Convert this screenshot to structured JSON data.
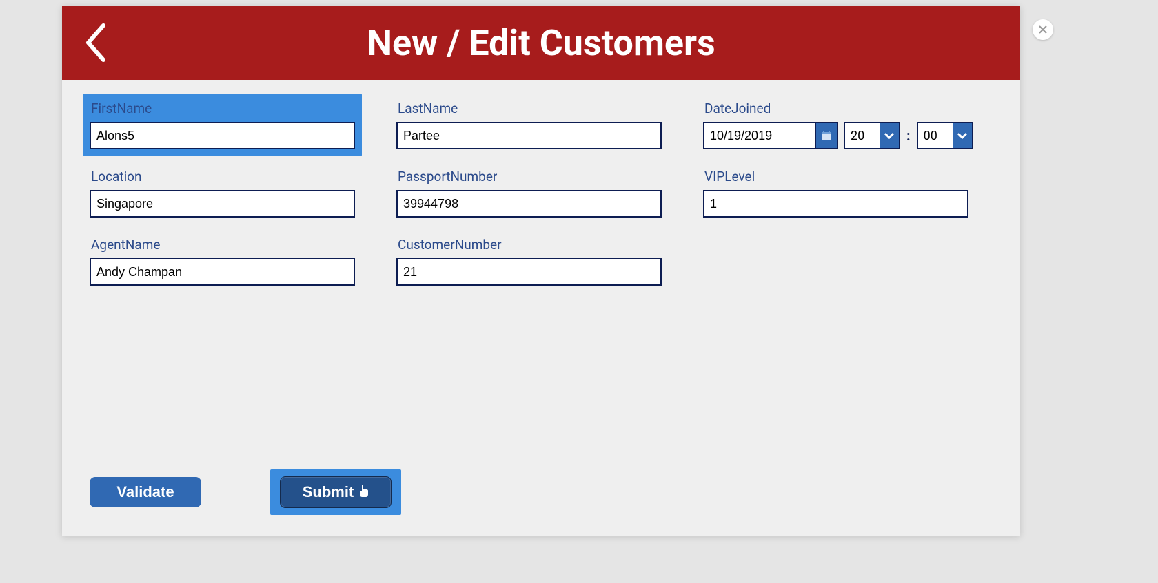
{
  "header": {
    "title": "New / Edit Customers"
  },
  "fields": {
    "firstName": {
      "label": "FirstName",
      "value": "Alons5"
    },
    "lastName": {
      "label": "LastName",
      "value": "Partee"
    },
    "dateJoined": {
      "label": "DateJoined",
      "date": "10/19/2019",
      "hour": "20",
      "minute": "00",
      "colon": ":"
    },
    "location": {
      "label": "Location",
      "value": "Singapore"
    },
    "passportNumber": {
      "label": "PassportNumber",
      "value": "39944798"
    },
    "vipLevel": {
      "label": "VIPLevel",
      "value": "1"
    },
    "agentName": {
      "label": "AgentName",
      "value": "Andy Champan"
    },
    "customerNumber": {
      "label": "CustomerNumber",
      "value": "21"
    }
  },
  "buttons": {
    "validate": "Validate",
    "submit": "Submit"
  }
}
